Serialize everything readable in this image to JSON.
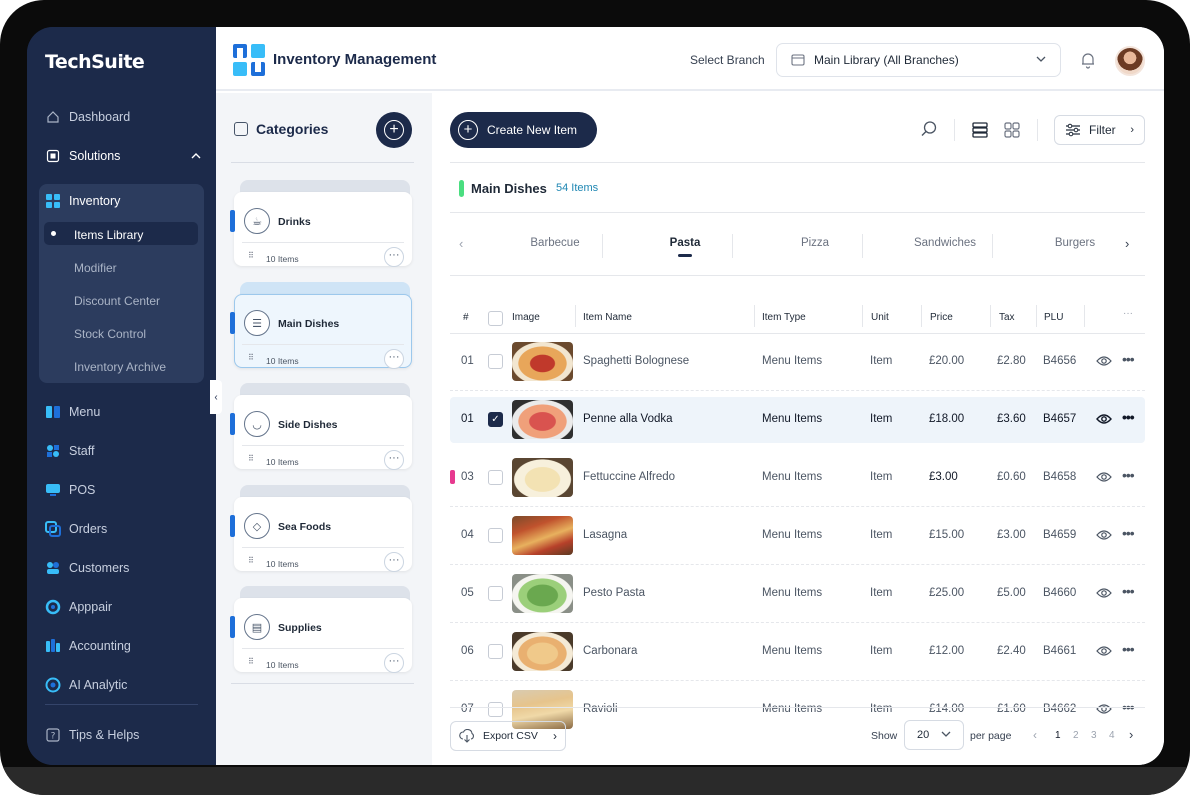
{
  "brand": {
    "logo_text": "TechSuite"
  },
  "sidebar": {
    "items": [
      {
        "label": "Dashboard"
      },
      {
        "label": "Solutions"
      },
      {
        "label": "Inventory"
      },
      {
        "label": "Menu"
      },
      {
        "label": "Staff"
      },
      {
        "label": "POS"
      },
      {
        "label": "Orders"
      },
      {
        "label": "Customers"
      },
      {
        "label": "Apppair"
      },
      {
        "label": "Accounting"
      },
      {
        "label": "AI Analytic"
      },
      {
        "label": "Tips & Helps"
      }
    ],
    "inventory_sub": [
      {
        "label": "Items Library"
      },
      {
        "label": "Modifier"
      },
      {
        "label": "Discount Center"
      },
      {
        "label": "Stock Control"
      },
      {
        "label": "Inventory Archive"
      }
    ]
  },
  "header": {
    "title": "Inventory Management",
    "branch_label": "Select Branch",
    "branch_value": "Main Library (All Branches)"
  },
  "categories": {
    "title": "Categories",
    "items": [
      {
        "name": "Drinks",
        "count": "10 Items",
        "icon": "drink-icon"
      },
      {
        "name": "Main Dishes",
        "count": "10 Items",
        "icon": "burger-icon"
      },
      {
        "name": "Side Dishes",
        "count": "10 Items",
        "icon": "bowl-icon"
      },
      {
        "name": "Sea Foods",
        "count": "10 Items",
        "icon": "fish-icon"
      },
      {
        "name": "Supplies",
        "count": "10 Items",
        "icon": "basket-icon"
      }
    ]
  },
  "toolbar": {
    "create_label": "Create New Item",
    "filter_label": "Filter"
  },
  "section": {
    "title": "Main Dishes",
    "count": "54 Items"
  },
  "subtabs": [
    "Barbecue",
    "Pasta",
    "Pizza",
    "Sandwiches",
    "Burgers"
  ],
  "active_subtab": "Pasta",
  "table": {
    "columns": [
      "#",
      "Image",
      "Item Name",
      "Item Type",
      "Unit",
      "Price",
      "Tax",
      "PLU"
    ],
    "rows": [
      {
        "no": "01",
        "name": "Spaghetti Bolognese",
        "type": "Menu Items",
        "unit": "Item",
        "price": "£20.00",
        "tax": "£2.80",
        "plu": "B4656",
        "selected": false
      },
      {
        "no": "01",
        "name": "Penne alla Vodka",
        "type": "Menu Items",
        "unit": "Item",
        "price": "£18.00",
        "tax": "£3.60",
        "plu": "B4657",
        "selected": true
      },
      {
        "no": "03",
        "name": "Fettuccine Alfredo",
        "type": "Menu Items",
        "unit": "Item",
        "price": "£3.00",
        "tax": "£0.60",
        "plu": "B4658",
        "selected": false
      },
      {
        "no": "04",
        "name": "Lasagna",
        "type": "Menu Items",
        "unit": "Item",
        "price": "£15.00",
        "tax": "£3.00",
        "plu": "B4659",
        "selected": false
      },
      {
        "no": "05",
        "name": "Pesto Pasta",
        "type": "Menu Items",
        "unit": "Item",
        "price": "£25.00",
        "tax": "£5.00",
        "plu": "B4660",
        "selected": false
      },
      {
        "no": "06",
        "name": "Carbonara",
        "type": "Menu Items",
        "unit": "Item",
        "price": "£12.00",
        "tax": "£2.40",
        "plu": "B4661",
        "selected": false
      },
      {
        "no": "07",
        "name": "Ravioli",
        "type": "Menu Items",
        "unit": "Item",
        "price": "£14.00",
        "tax": "£1.60",
        "plu": "B4662",
        "selected": false
      }
    ]
  },
  "footer": {
    "export_label": "Export CSV",
    "show_label": "Show",
    "page_size": "20",
    "per_page_label": "per page",
    "pages": [
      "1",
      "2",
      "3",
      "4"
    ],
    "current_page": "1"
  },
  "colors": {
    "navy": "#1c2a4a",
    "accent_blue": "#1e6fd9",
    "green": "#4ade80",
    "pink": "#e7398f",
    "teal": "#1f87b3"
  }
}
